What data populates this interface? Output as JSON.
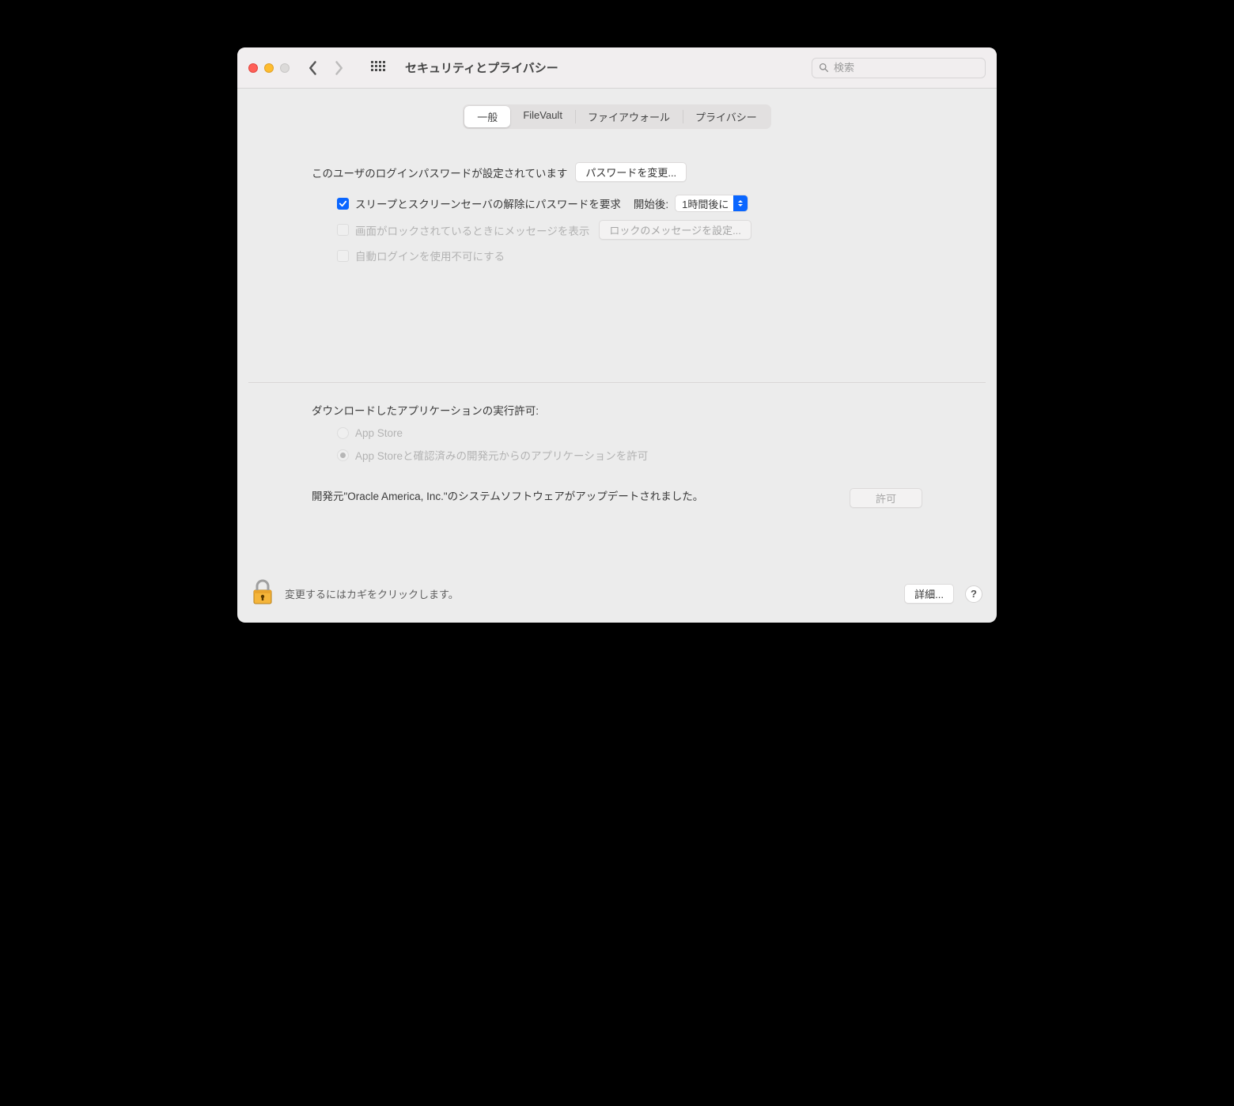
{
  "window": {
    "title": "セキュリティとプライバシー",
    "search_placeholder": "検索"
  },
  "tabs": {
    "general": "一般",
    "filevault": "FileVault",
    "firewall": "ファイアウォール",
    "privacy": "プライバシー"
  },
  "general": {
    "password_set_label": "このユーザのログインパスワードが設定されています",
    "change_password_btn": "パスワードを変更...",
    "require_password_label": "スリープとスクリーンセーバの解除にパスワードを要求",
    "after_label": "開始後:",
    "after_value": "1時間後に",
    "lock_message_label": "画面がロックされているときにメッセージを表示",
    "set_lock_message_btn": "ロックのメッセージを設定...",
    "disable_autologin_label": "自動ログインを使用不可にする",
    "downloads_heading": "ダウンロードしたアプリケーションの実行許可:",
    "radio_appstore": "App Store",
    "radio_identified": "App Storeと確認済みの開発元からのアプリケーションを許可",
    "update_text": "開発元\"Oracle America, Inc.\"のシステムソフトウェアがアップデートされました。",
    "allow_btn": "許可"
  },
  "footer": {
    "lock_text": "変更するにはカギをクリックします。",
    "details_btn": "詳細...",
    "help": "?"
  }
}
